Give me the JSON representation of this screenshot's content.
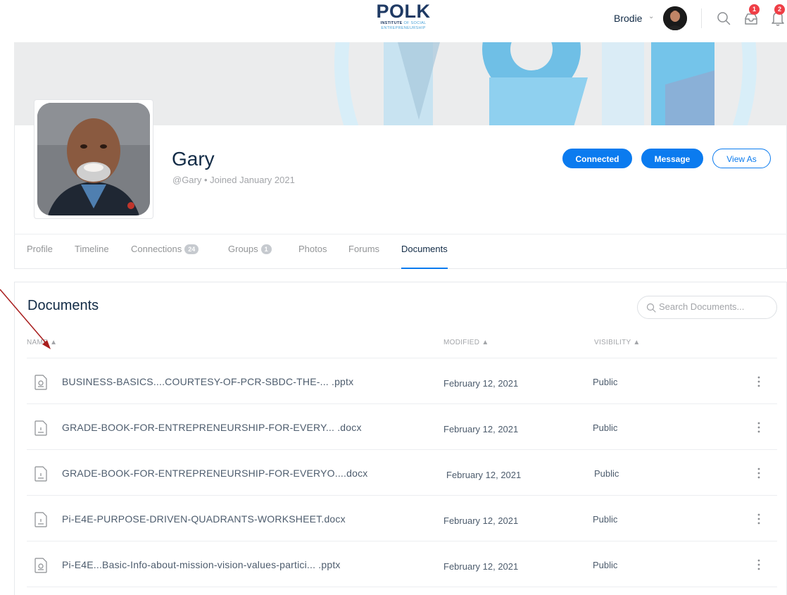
{
  "header": {
    "logo": {
      "main": "POLK",
      "line1_bold": "INSTITUTE",
      "line1_light": "OF SOCIAL",
      "line2": "ENTREPRENEURSHIP"
    },
    "user_name": "Brodie",
    "messages_badge": "1",
    "notifications_badge": "2"
  },
  "profile": {
    "name": "Gary",
    "meta": "@Gary • Joined January 2021",
    "buttons": {
      "connected": "Connected",
      "message": "Message",
      "view_as": "View As"
    }
  },
  "tabs": [
    {
      "label": "Profile"
    },
    {
      "label": "Timeline"
    },
    {
      "label": "Connections",
      "count": "24"
    },
    {
      "label": "Groups",
      "count": "1"
    },
    {
      "label": "Photos"
    },
    {
      "label": "Forums"
    },
    {
      "label": "Documents",
      "active": true
    }
  ],
  "documents": {
    "title": "Documents",
    "search_placeholder": "Search Documents...",
    "columns": {
      "name": "NAME ▲",
      "modified": "MODIFIED ▲",
      "visibility": "VISIBILITY ▲"
    },
    "rows": [
      {
        "name": "BUSINESS-BASICS....COURTESY-OF-PCR-SBDC-THE-... .pptx",
        "modified": "February 12, 2021",
        "visibility": "Public",
        "type": "pptx"
      },
      {
        "name": "GRADE-BOOK-FOR-ENTREPRENEURSHIP-FOR-EVERY... .docx",
        "modified": "February 12, 2021",
        "visibility": "Public",
        "type": "docx"
      },
      {
        "name": "GRADE-BOOK-FOR-ENTREPRENEURSHIP-FOR-EVERYO....docx",
        "modified": "February 12, 2021",
        "visibility": "Public",
        "type": "docx"
      },
      {
        "name": "Pi-E4E-PURPOSE-DRIVEN-QUADRANTS-WORKSHEET.docx",
        "modified": "February 12, 2021",
        "visibility": "Public",
        "type": "docx"
      },
      {
        "name": "Pi-E4E...Basic-Info-about-mission-vision-values-partici... .pptx",
        "modified": "February 12, 2021",
        "visibility": "Public",
        "type": "pptx"
      }
    ]
  },
  "colors": {
    "accent": "#0b7bef",
    "text": "#122b46",
    "muted": "#a3a5a9",
    "badge": "#ef3e46",
    "annotation": "#a81d1d"
  },
  "icons": [
    "search-icon",
    "inbox-icon",
    "bell-icon",
    "chevron-down-icon",
    "file-icon",
    "kebab-menu-icon",
    "arrow-annotation"
  ]
}
